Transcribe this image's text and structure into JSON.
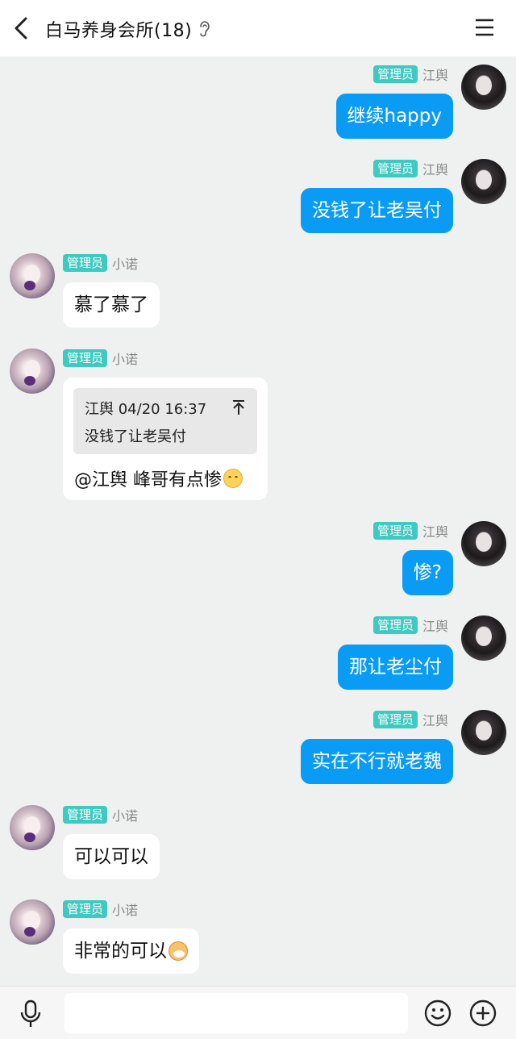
{
  "header": {
    "title": "白马养身会所(18)",
    "back_icon": "chevron-left-icon",
    "ear_icon": "ear-icon",
    "menu_icon": "hamburger-menu-icon"
  },
  "colors": {
    "sent_bubble": "#0a9cf5",
    "received_bubble": "#ffffff",
    "badge": "#3ec9c1",
    "background": "#eef1ef"
  },
  "messages": [
    {
      "side": "right",
      "badge": "管理员",
      "nick": "江舆",
      "text": "继续happy"
    },
    {
      "side": "right",
      "badge": "管理员",
      "nick": "江舆",
      "text": "没钱了让老吴付"
    },
    {
      "side": "left",
      "badge": "管理员",
      "nick": "小诺",
      "text": "慕了慕了"
    },
    {
      "side": "left",
      "badge": "管理员",
      "nick": "小诺",
      "quote": {
        "author_time": "江舆 04/20 16:37",
        "text": "没钱了让老吴付"
      },
      "text": "@江舆 峰哥有点惨",
      "emoji": "smirk-emoji"
    },
    {
      "side": "right",
      "badge": "管理员",
      "nick": "江舆",
      "text": "惨?"
    },
    {
      "side": "right",
      "badge": "管理员",
      "nick": "江舆",
      "text": "那让老尘付"
    },
    {
      "side": "right",
      "badge": "管理员",
      "nick": "江舆",
      "text": "实在不行就老魏"
    },
    {
      "side": "left",
      "badge": "管理员",
      "nick": "小诺",
      "text": "可以可以"
    },
    {
      "side": "left",
      "badge": "管理员",
      "nick": "小诺",
      "text": "非常的可以",
      "emoji": "shiba-emoji"
    }
  ],
  "composer": {
    "input_value": "",
    "placeholder": "",
    "mic_icon": "microphone-icon",
    "emoji_icon": "smiley-icon",
    "plus_icon": "plus-circle-icon"
  }
}
